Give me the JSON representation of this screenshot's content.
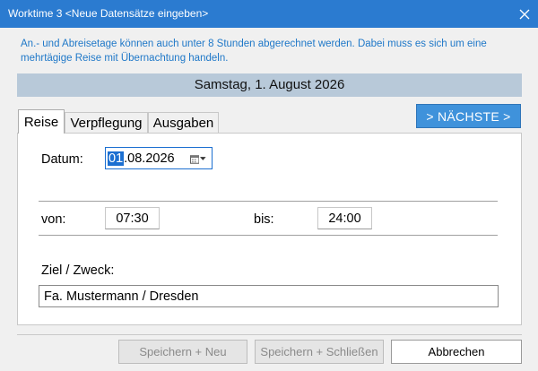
{
  "window": {
    "title": "Worktime 3 <Neue Datensätze eingeben>"
  },
  "info_text": "An.- und Abreisetage können auch unter 8 Stunden abgerechnet werden. Dabei muss es sich um eine mehrtägige Reise mit Übernachtung handeln.",
  "date_header": "Samstag, 1. August 2026",
  "tabs": [
    {
      "label": "Reise",
      "active": true
    },
    {
      "label": "Verpflegung",
      "active": false
    },
    {
      "label": "Ausgaben",
      "active": false
    }
  ],
  "next_button": "> NÄCHSTE >",
  "form": {
    "date_label": "Datum:",
    "date_selected_part": "01",
    "date_rest": ".08.2026",
    "von_label": "von:",
    "von_value": "07:30",
    "bis_label": "bis:",
    "bis_value": "24:00",
    "purpose_label": "Ziel / Zweck:",
    "purpose_value": "Fa. Mustermann / Dresden"
  },
  "buttons": {
    "save_new": "Speichern + Neu",
    "save_close": "Speichern + Schließen",
    "cancel": "Abbrechen"
  },
  "icons": {
    "close": "close-icon",
    "calendar": "calendar-icon",
    "dropdown": "chevron-down-icon"
  },
  "colors": {
    "titlebar": "#2b7bd0",
    "info_text": "#1f78c8",
    "accent_button": "#3f92db",
    "date_bar": "#b8c9d9"
  }
}
